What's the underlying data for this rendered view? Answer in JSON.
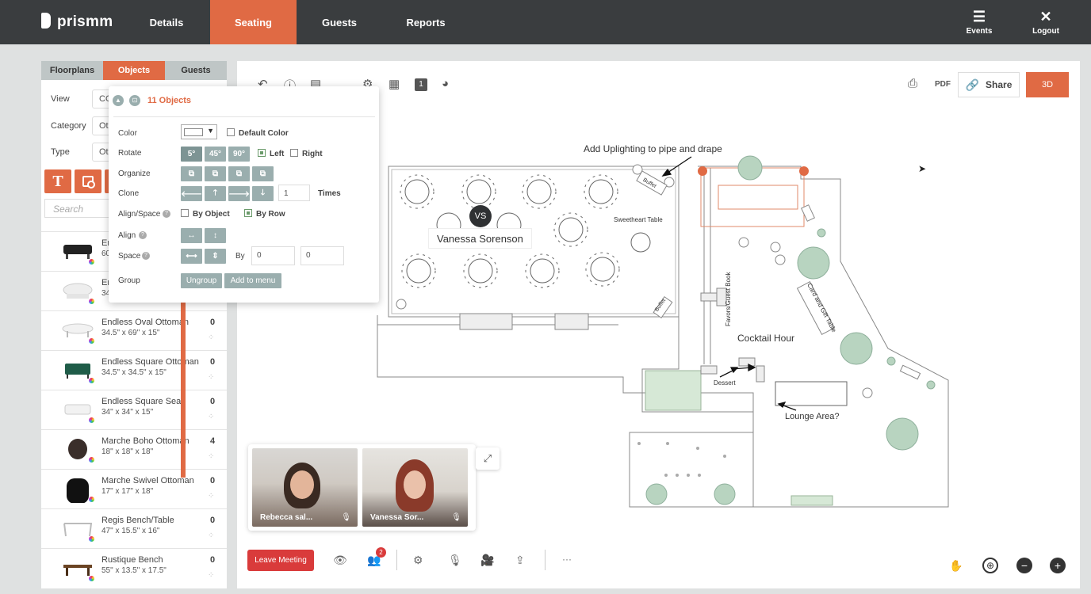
{
  "app": {
    "logo": "prismm"
  },
  "nav": {
    "tabs": [
      "Details",
      "Seating",
      "Guests",
      "Reports"
    ],
    "events_label": "Events",
    "logout_label": "Logout"
  },
  "sidebar": {
    "tabs": [
      "Floorplans",
      "Objects",
      "Guests"
    ],
    "view_label": "View",
    "view_value": "CO",
    "category_label": "Category",
    "category_value": "Ot",
    "type_label": "Type",
    "type_value": "Ot",
    "search_placeholder": "Search",
    "partial_items": [
      {
        "name": "Er",
        "dims": "60"
      },
      {
        "name": "Er",
        "dims": "34"
      }
    ],
    "items": [
      {
        "name": "Endless Oval Ottoman",
        "dims": "34.5\" x 69\" x 15\"",
        "count": "0"
      },
      {
        "name": "Endless Square Ottoman",
        "dims": "34.5\" x 34.5\" x 15\"",
        "count": "0"
      },
      {
        "name": "Endless Square Seat",
        "dims": "34\" x 34\" x 15\"",
        "count": "0"
      },
      {
        "name": "Marche Boho Ottoman",
        "dims": "18\" x 18\" x 18\"",
        "count": "4"
      },
      {
        "name": "Marche Swivel Ottoman",
        "dims": "17\" x 17\" x 18\"",
        "count": "0"
      },
      {
        "name": "Regis Bench/Table",
        "dims": "47\" x 15.5\" x 16\"",
        "count": "0"
      },
      {
        "name": "Rustique Bench",
        "dims": "55\" x 13.5\" x 17.5\"",
        "count": "0"
      }
    ]
  },
  "panel": {
    "title": "11 Objects",
    "color_label": "Color",
    "default_color_label": "Default Color",
    "rotate_label": "Rotate",
    "rotate_options": [
      "5°",
      "45°",
      "90°"
    ],
    "left_label": "Left",
    "right_label": "Right",
    "organize_label": "Organize",
    "clone_label": "Clone",
    "clone_value": "1",
    "times_label": "Times",
    "align_space_label": "Align/Space",
    "by_object_label": "By Object",
    "by_row_label": "By Row",
    "align_label": "Align",
    "space_label": "Space",
    "by_label": "By",
    "space_x": "0",
    "space_y": "0",
    "group_label": "Group",
    "ungroup_label": "Ungroup",
    "add_menu_label": "Add to menu"
  },
  "toolbar": {
    "pdf_label": "PDF",
    "share_label": "Share",
    "threed_label": "3D",
    "page_num": "1"
  },
  "floorplan": {
    "uplighting_note": "Add Uplighting to pipe and drape",
    "sweetheart_label": "Sweetheart Table",
    "buffet_label": "Buffet",
    "favors_label": "Favors/Guest Book",
    "card_gift_label": "Card and Gift Table",
    "cocktail_label": "Cocktail Hour",
    "dessert_label": "Dessert",
    "lounge_label": "Lounge Area?",
    "cursor_initials": "VS",
    "cursor_name": "Vanessa Sorenson"
  },
  "meeting": {
    "participants": [
      {
        "name": "Rebecca sal..."
      },
      {
        "name": "Vanessa Sor..."
      }
    ],
    "leave_label": "Leave Meeting",
    "participants_badge": "2",
    "more_label": "···"
  },
  "colors": {
    "accent": "#e06a44",
    "nav_bg": "#3a3d3f",
    "leave": "#d93b3b",
    "button_gray": "#9aaeae"
  }
}
